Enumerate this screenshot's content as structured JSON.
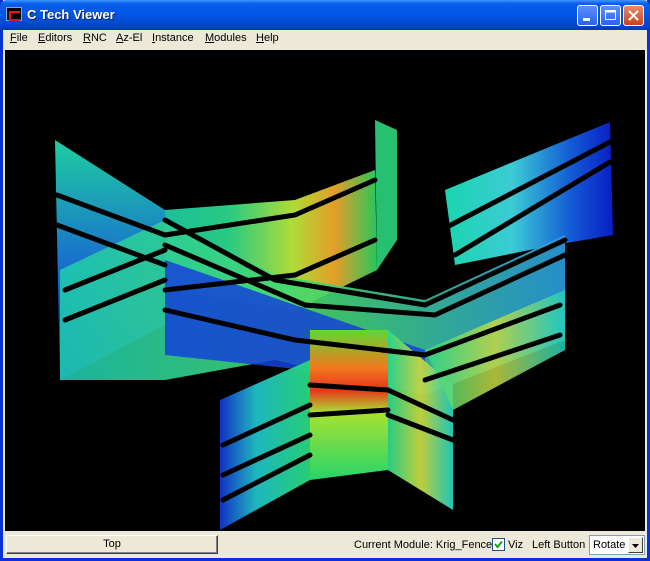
{
  "window": {
    "title": "C Tech Viewer"
  },
  "menu": [
    "File",
    "Editors",
    "RNC",
    "Az-El",
    "Instance",
    "Modules",
    "Help"
  ],
  "menu_mnemonic": [
    0,
    0,
    0,
    0,
    0,
    0,
    0
  ],
  "status": {
    "view_button": "Top",
    "current_module_label": "Current Module: Krig_Fence",
    "viz_label": "Viz",
    "viz_checked": true,
    "left_button_label": "Left Button",
    "left_button_value": "Rotate"
  },
  "scene": {
    "background": "#000000",
    "subject": "3d-fence-diagram"
  },
  "icons": [
    "app-icon",
    "minimize-icon",
    "maximize-icon",
    "close-icon",
    "checkmark-icon",
    "dropdown-arrow-icon"
  ]
}
